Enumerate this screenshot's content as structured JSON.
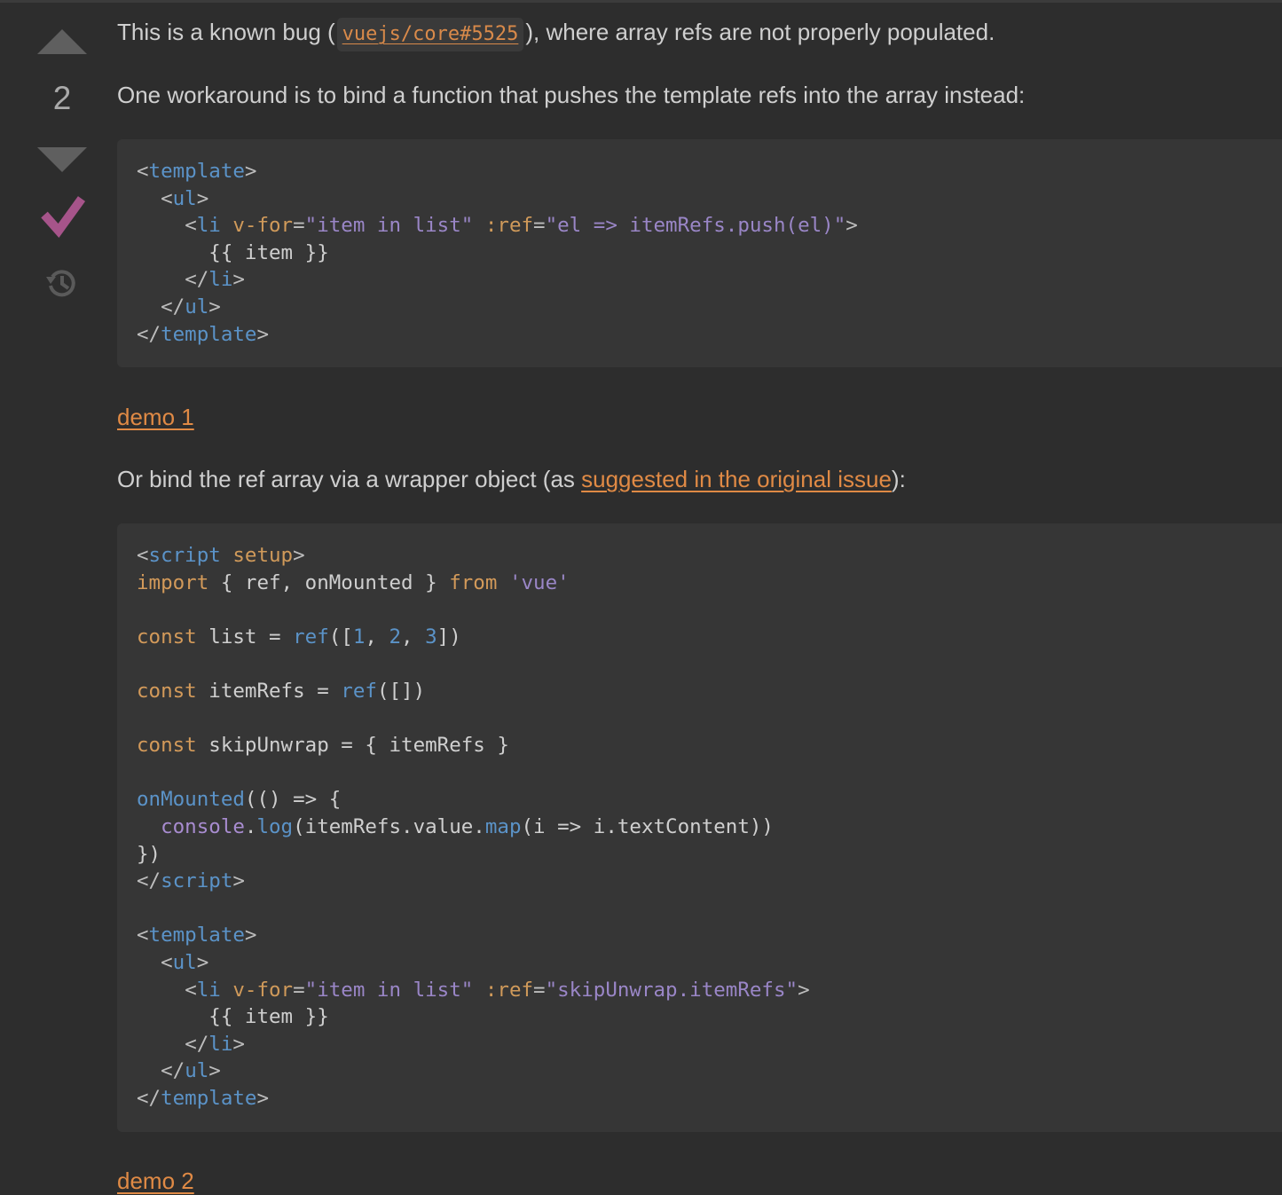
{
  "vote": {
    "count": "2",
    "upvote_icon": "caret-up-icon",
    "downvote_icon": "caret-down-icon",
    "accepted_icon": "checkmark-icon",
    "history_icon": "history-icon",
    "arrow_color": "#5f5f5f",
    "accepted_color": "#a6548a"
  },
  "answer": {
    "para1": {
      "before": "This is a known bug (",
      "code_link": "vuejs/core#5525",
      "after": "), where array refs are not properly populated."
    },
    "para2": "One workaround is to bind a function that pushes the template refs into the array instead:",
    "demo1": "demo 1",
    "para3": {
      "before": "Or bind the ref array via a wrapper object (as ",
      "link": "suggested in the original issue",
      "after": "):"
    },
    "demo2": "demo 2",
    "code1": [
      [
        [
          "c-punc",
          "<"
        ],
        [
          "c-tag",
          "template"
        ],
        [
          "c-punc",
          ">"
        ]
      ],
      [
        [
          "c-plain",
          "  "
        ],
        [
          "c-punc",
          "<"
        ],
        [
          "c-tag",
          "ul"
        ],
        [
          "c-punc",
          ">"
        ]
      ],
      [
        [
          "c-plain",
          "    "
        ],
        [
          "c-punc",
          "<"
        ],
        [
          "c-tag",
          "li"
        ],
        [
          "c-plain",
          " "
        ],
        [
          "c-attr",
          "v-for"
        ],
        [
          "c-punc",
          "="
        ],
        [
          "c-str",
          "\"item in list\""
        ],
        [
          "c-plain",
          " "
        ],
        [
          "c-attr",
          ":ref"
        ],
        [
          "c-punc",
          "="
        ],
        [
          "c-str",
          "\"el => itemRefs.push(el)\""
        ],
        [
          "c-punc",
          ">"
        ]
      ],
      [
        [
          "c-plain",
          "      {{ item }}"
        ]
      ],
      [
        [
          "c-plain",
          "    "
        ],
        [
          "c-punc",
          "</"
        ],
        [
          "c-tag",
          "li"
        ],
        [
          "c-punc",
          ">"
        ]
      ],
      [
        [
          "c-plain",
          "  "
        ],
        [
          "c-punc",
          "</"
        ],
        [
          "c-tag",
          "ul"
        ],
        [
          "c-punc",
          ">"
        ]
      ],
      [
        [
          "c-punc",
          "</"
        ],
        [
          "c-tag",
          "template"
        ],
        [
          "c-punc",
          ">"
        ]
      ]
    ],
    "code2": [
      [
        [
          "c-punc",
          "<"
        ],
        [
          "c-tag",
          "script"
        ],
        [
          "c-plain",
          " "
        ],
        [
          "c-attr",
          "setup"
        ],
        [
          "c-punc",
          ">"
        ]
      ],
      [
        [
          "c-kw",
          "import"
        ],
        [
          "c-plain",
          " { ref, onMounted } "
        ],
        [
          "c-kw",
          "from"
        ],
        [
          "c-plain",
          " "
        ],
        [
          "c-str",
          "'vue'"
        ]
      ],
      [],
      [
        [
          "c-kw",
          "const"
        ],
        [
          "c-plain",
          " list = "
        ],
        [
          "c-fn",
          "ref"
        ],
        [
          "c-plain",
          "(["
        ],
        [
          "c-num",
          "1"
        ],
        [
          "c-plain",
          ", "
        ],
        [
          "c-num",
          "2"
        ],
        [
          "c-plain",
          ", "
        ],
        [
          "c-num",
          "3"
        ],
        [
          "c-plain",
          "])"
        ]
      ],
      [],
      [
        [
          "c-kw",
          "const"
        ],
        [
          "c-plain",
          " itemRefs = "
        ],
        [
          "c-fn",
          "ref"
        ],
        [
          "c-plain",
          "([])"
        ]
      ],
      [],
      [
        [
          "c-kw",
          "const"
        ],
        [
          "c-plain",
          " skipUnwrap = { itemRefs }"
        ]
      ],
      [],
      [
        [
          "c-fn",
          "onMounted"
        ],
        [
          "c-plain",
          "(() => {"
        ]
      ],
      [
        [
          "c-plain",
          "  "
        ],
        [
          "c-obj",
          "console"
        ],
        [
          "c-plain",
          "."
        ],
        [
          "c-fn",
          "log"
        ],
        [
          "c-plain",
          "(itemRefs.value."
        ],
        [
          "c-fn",
          "map"
        ],
        [
          "c-plain",
          "(i => i.textContent))"
        ]
      ],
      [
        [
          "c-plain",
          "})"
        ]
      ],
      [
        [
          "c-punc",
          "</"
        ],
        [
          "c-tag",
          "script"
        ],
        [
          "c-punc",
          ">"
        ]
      ],
      [],
      [
        [
          "c-punc",
          "<"
        ],
        [
          "c-tag",
          "template"
        ],
        [
          "c-punc",
          ">"
        ]
      ],
      [
        [
          "c-plain",
          "  "
        ],
        [
          "c-punc",
          "<"
        ],
        [
          "c-tag",
          "ul"
        ],
        [
          "c-punc",
          ">"
        ]
      ],
      [
        [
          "c-plain",
          "    "
        ],
        [
          "c-punc",
          "<"
        ],
        [
          "c-tag",
          "li"
        ],
        [
          "c-plain",
          " "
        ],
        [
          "c-attr",
          "v-for"
        ],
        [
          "c-punc",
          "="
        ],
        [
          "c-str",
          "\"item in list\""
        ],
        [
          "c-plain",
          " "
        ],
        [
          "c-attr",
          ":ref"
        ],
        [
          "c-punc",
          "="
        ],
        [
          "c-str",
          "\"skipUnwrap.itemRefs\""
        ],
        [
          "c-punc",
          ">"
        ]
      ],
      [
        [
          "c-plain",
          "      {{ item }}"
        ]
      ],
      [
        [
          "c-plain",
          "    "
        ],
        [
          "c-punc",
          "</"
        ],
        [
          "c-tag",
          "li"
        ],
        [
          "c-punc",
          ">"
        ]
      ],
      [
        [
          "c-plain",
          "  "
        ],
        [
          "c-punc",
          "</"
        ],
        [
          "c-tag",
          "ul"
        ],
        [
          "c-punc",
          ">"
        ]
      ],
      [
        [
          "c-punc",
          "</"
        ],
        [
          "c-tag",
          "template"
        ],
        [
          "c-punc",
          ">"
        ]
      ]
    ]
  }
}
